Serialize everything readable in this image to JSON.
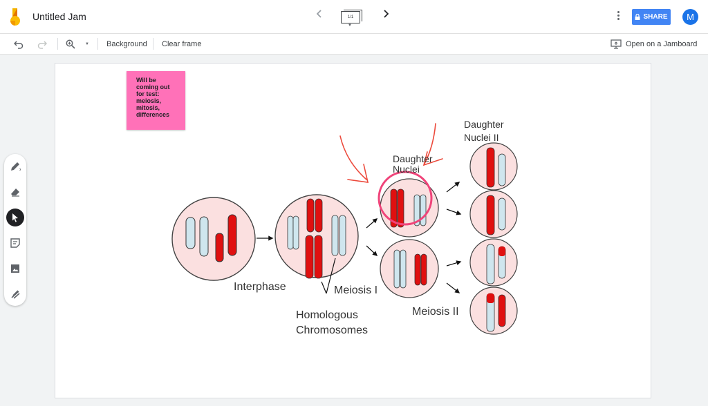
{
  "app": {
    "title": "Untitled Jam",
    "frame_indicator": "1/1",
    "share_label": "SHARE",
    "avatar_initial": "M",
    "accent": "#4285f4",
    "avatar_color": "#1a73e8"
  },
  "toolbar": {
    "undo_icon": "undo-icon",
    "redo_icon": "redo-icon",
    "zoom_icon": "zoom-in-icon",
    "background_label": "Background",
    "clear_frame_label": "Clear frame",
    "open_jamboard_label": "Open on a Jamboard"
  },
  "tools": [
    "pen-icon",
    "eraser-icon",
    "select-icon",
    "sticky-note-icon",
    "image-icon",
    "laser-icon"
  ],
  "sticky_note": {
    "lines": [
      "Will be",
      "coming out",
      "for test:",
      "meiosis,",
      "mitosis,",
      "differences"
    ],
    "color": "#ff71b8"
  },
  "diagram": {
    "labels": {
      "interphase": "Interphase",
      "meiosis_1": "Meiosis I",
      "meiosis_2": "Meiosis II",
      "homologous_1": "Homologous",
      "homologous_2": "Chromosomes",
      "daughter_nuclei_1": "Daughter",
      "daughter_nuclei_2": "Nuclei",
      "daughter_nuclei_ii_1": "Daughter",
      "daughter_nuclei_ii_2": "Nuclei II"
    },
    "cell_fill": "#fbe0e0",
    "chromosome_red": "#e01010",
    "chromosome_blue": "#cfe6ee",
    "annotation_color": "#ec4a3c",
    "highlight_circle_color": "#f0447a"
  }
}
